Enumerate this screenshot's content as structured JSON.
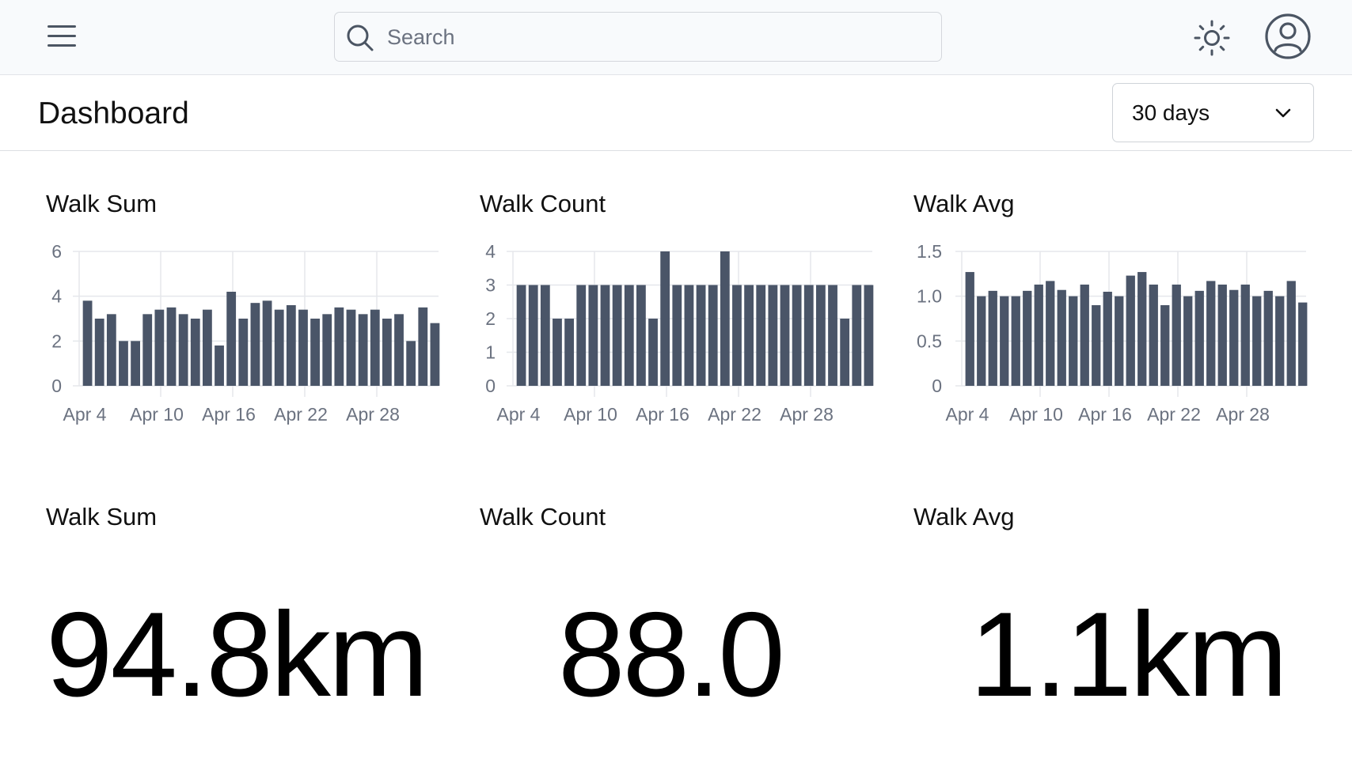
{
  "topbar": {
    "menu_icon": "hamburger-icon",
    "search_placeholder": "Search",
    "search_icon": "search-icon",
    "theme_icon": "sun-icon",
    "account_icon": "user-circle-icon"
  },
  "header": {
    "title": "Dashboard",
    "range_selected": "30 days"
  },
  "colors": {
    "bar": "#4a5568",
    "grid": "#e5e7eb",
    "axis_text": "#6b7280"
  },
  "cards": {
    "sum_title": "Walk Sum",
    "count_title": "Walk Count",
    "avg_title": "Walk Avg",
    "stat_sum_title": "Walk Sum",
    "stat_count_title": "Walk Count",
    "stat_avg_title": "Walk Avg",
    "stat_sum_value": "94.8km",
    "stat_count_value": "88.0",
    "stat_avg_value": "1.1km"
  },
  "chart_data": [
    {
      "type": "bar",
      "title": "Walk Sum",
      "ylim": [
        0,
        6
      ],
      "yticks": [
        "0",
        "2",
        "4",
        "6"
      ],
      "xticks": [
        "Apr 4",
        "Apr 10",
        "Apr 16",
        "Apr 22",
        "Apr 28"
      ],
      "values": [
        3.8,
        3.0,
        3.2,
        2.0,
        2.0,
        3.2,
        3.4,
        3.5,
        3.2,
        3.0,
        3.4,
        1.8,
        4.2,
        3.0,
        3.7,
        3.8,
        3.4,
        3.6,
        3.4,
        3.0,
        3.2,
        3.5,
        3.4,
        3.2,
        3.4,
        3.0,
        3.2,
        2.0,
        3.5,
        2.8
      ]
    },
    {
      "type": "bar",
      "title": "Walk Count",
      "ylim": [
        0,
        4
      ],
      "yticks": [
        "0",
        "1",
        "2",
        "3",
        "4"
      ],
      "xticks": [
        "Apr 4",
        "Apr 10",
        "Apr 16",
        "Apr 22",
        "Apr 28"
      ],
      "values": [
        3,
        3,
        3,
        2,
        2,
        3,
        3,
        3,
        3,
        3,
        3,
        2,
        4,
        3,
        3,
        3,
        3,
        4,
        3,
        3,
        3,
        3,
        3,
        3,
        3,
        3,
        3,
        2,
        3,
        3
      ]
    },
    {
      "type": "bar",
      "title": "Walk Avg",
      "ylim": [
        0,
        1.5
      ],
      "yticks": [
        "0",
        "0.5",
        "1.0",
        "1.5"
      ],
      "xticks": [
        "Apr 4",
        "Apr 10",
        "Apr 16",
        "Apr 22",
        "Apr 28"
      ],
      "values": [
        1.27,
        1.0,
        1.06,
        1.0,
        1.0,
        1.06,
        1.13,
        1.17,
        1.07,
        1.0,
        1.13,
        0.9,
        1.05,
        1.0,
        1.23,
        1.27,
        1.13,
        0.9,
        1.13,
        1.0,
        1.06,
        1.17,
        1.13,
        1.07,
        1.13,
        1.0,
        1.06,
        1.0,
        1.17,
        0.93
      ]
    }
  ]
}
